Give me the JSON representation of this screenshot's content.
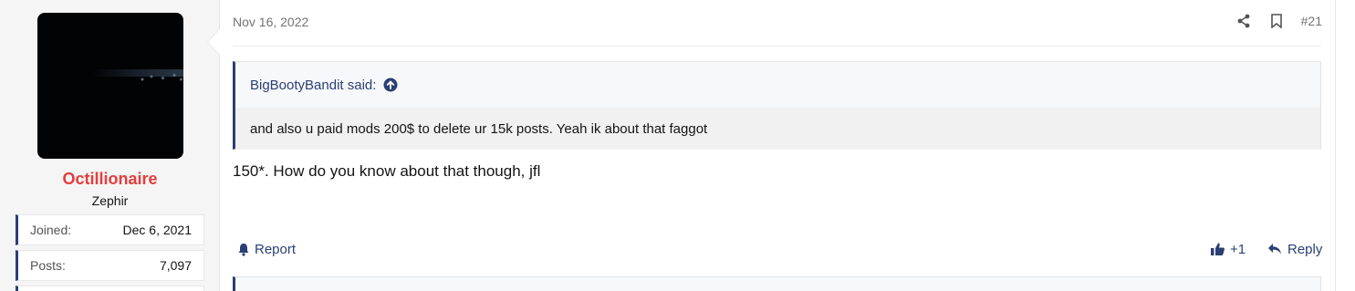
{
  "user": {
    "name": "Octillionaire",
    "title": "Zephir",
    "joined_label": "Joined:",
    "joined_value": "Dec 6, 2021",
    "posts_label": "Posts:",
    "posts_value": "7,097"
  },
  "post": {
    "date": "Nov 16, 2022",
    "number": "#21",
    "quote_author": "BigBootyBandit said:",
    "quote_text": "and also u paid mods 200$ to delete ur 15k posts. Yeah ik about that faggot",
    "body": "150*. How do you know about that though, jfl",
    "report_label": "Report",
    "reaction_count": "+1",
    "reply_label": "Reply"
  },
  "colors": {
    "accent": "#2b3f74",
    "username": "#e43d3d"
  },
  "icons": [
    "share-icon",
    "bookmark-icon",
    "arrow-up-circle-icon",
    "bell-icon",
    "thumbs-up-icon",
    "reply-icon"
  ]
}
